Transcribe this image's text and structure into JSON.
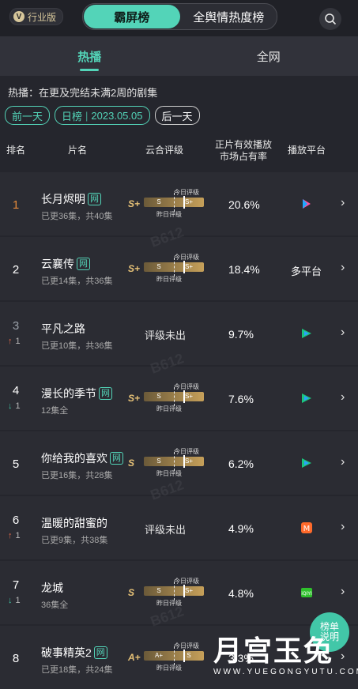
{
  "header": {
    "badge": "行业版",
    "segments": [
      "霸屏榜",
      "全舆情热度榜"
    ],
    "active_segment": 0
  },
  "tabs": {
    "items": [
      "热播",
      "全网"
    ],
    "active": 0
  },
  "description": "热播：在更及完结未满2周的剧集",
  "date_bar": {
    "prev": "前一天",
    "mode": "日榜",
    "date": "2023.05.05",
    "next": "后一天"
  },
  "table_header": {
    "rank": "排名",
    "title": "片名",
    "grade": "云合评级",
    "share_line1": "正片有效播放",
    "share_line2": "市场占有率",
    "platform": "播放平台"
  },
  "grade_labels": {
    "today": "今日评级",
    "yesterday": "昨日评级"
  },
  "rows": [
    {
      "rank": "1",
      "trend": "",
      "trend_num": "",
      "title": "长月烬明",
      "online_only": true,
      "sub": "已更36集，共40集",
      "grade": "S+",
      "bar": [
        "S",
        "S+"
      ],
      "share": "20.6%",
      "platform_icon": "youku-icon",
      "platform_text": ""
    },
    {
      "rank": "2",
      "trend": "",
      "trend_num": "",
      "title": "云襄传",
      "online_only": true,
      "sub": "已更14集，共36集",
      "grade": "S+",
      "bar": [
        "S",
        "S+"
      ],
      "share": "18.4%",
      "platform_icon": "",
      "platform_text": "多平台"
    },
    {
      "rank": "3",
      "trend": "up",
      "trend_num": "1",
      "title": "平凡之路",
      "online_only": false,
      "sub": "已更10集，共36集",
      "grade": "",
      "no_grade": "评级未出",
      "share": "9.7%",
      "platform_icon": "tencent-video-icon",
      "platform_text": ""
    },
    {
      "rank": "4",
      "trend": "down",
      "trend_num": "1",
      "title": "漫长的季节",
      "online_only": true,
      "sub": "12集全",
      "grade": "S+",
      "bar": [
        "S",
        "S+"
      ],
      "share": "7.6%",
      "platform_icon": "tencent-video-icon",
      "platform_text": ""
    },
    {
      "rank": "5",
      "trend": "",
      "trend_num": "",
      "title": "你给我的喜欢",
      "online_only": true,
      "sub": "已更16集，共28集",
      "grade": "S",
      "bar": [
        "S",
        "S+"
      ],
      "share": "6.2%",
      "platform_icon": "tencent-video-icon",
      "platform_text": ""
    },
    {
      "rank": "6",
      "trend": "up",
      "trend_num": "1",
      "title": "温暖的甜蜜的",
      "online_only": false,
      "sub": "已更9集，共38集",
      "grade": "",
      "no_grade": "评级未出",
      "share": "4.9%",
      "platform_icon": "mgtv-icon",
      "platform_text": ""
    },
    {
      "rank": "7",
      "trend": "down",
      "trend_num": "1",
      "title": "龙城",
      "online_only": false,
      "sub": "36集全",
      "grade": "S",
      "bar": [
        "S",
        "S+"
      ],
      "share": "4.8%",
      "platform_icon": "iqiyi-icon",
      "platform_text": ""
    },
    {
      "rank": "8",
      "trend": "",
      "trend_num": "",
      "title": "破事精英2",
      "online_only": true,
      "sub": "已更18集，共24集",
      "grade": "A+",
      "bar": [
        "A+",
        "S"
      ],
      "share": "3.3%",
      "platform_icon": "",
      "platform_text": ""
    }
  ],
  "online_tag": "网",
  "float_button": [
    "榜单",
    "说明"
  ],
  "watermark": {
    "brand": "月宫玉兔",
    "url": "WWW.YUEGONGYUTU.COM"
  },
  "colors": {
    "accent": "#53d4b8",
    "rank_top": "#e58a3b",
    "trend_up": "#e56a4a",
    "trend_down": "#3fc6a3",
    "grade": "#e7c277"
  }
}
